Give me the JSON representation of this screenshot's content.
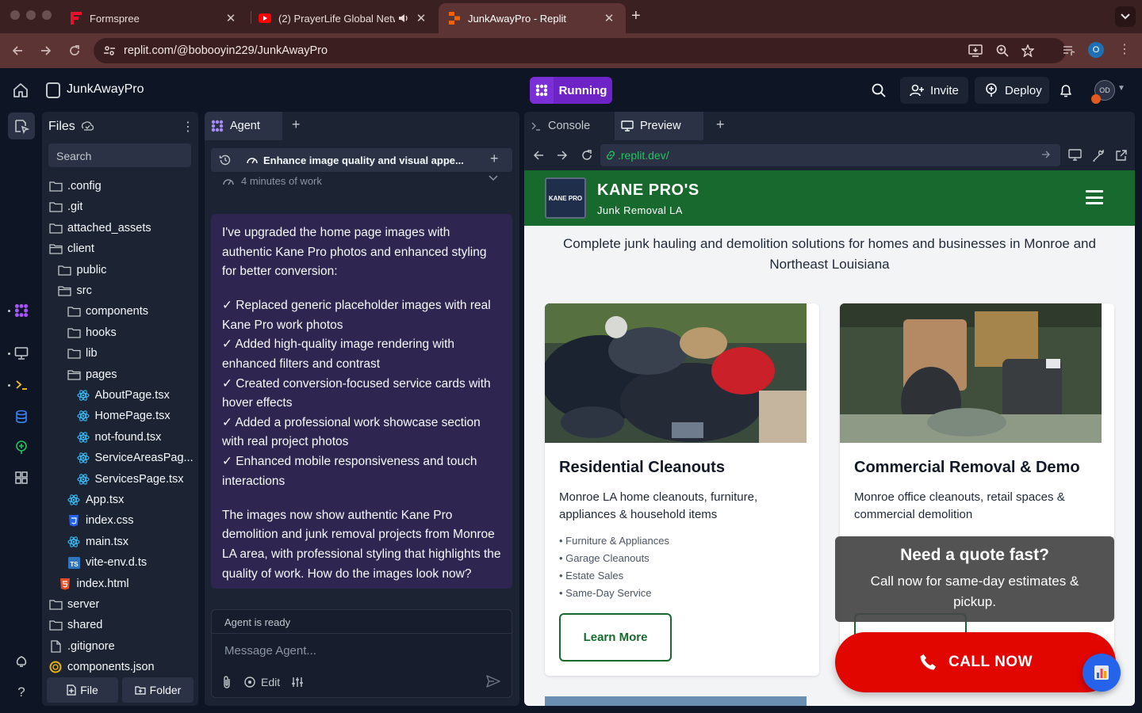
{
  "browser": {
    "tabs": [
      {
        "title": "Formspree",
        "icon": "formspree-icon"
      },
      {
        "title": "(2) PrayerLife Global Netw",
        "icon": "youtube-icon"
      },
      {
        "title": "JunkAwayPro - Replit",
        "icon": "replit-icon"
      }
    ],
    "url": "replit.com/@bobooyin229/JunkAwayPro",
    "profile_initial": "O"
  },
  "header": {
    "repl_name": "JunkAwayPro",
    "run_label": "Running",
    "invite_label": "Invite",
    "deploy_label": "Deploy",
    "avatar_initials": "OD"
  },
  "files": {
    "title": "Files",
    "search_placeholder": "Search",
    "tree": [
      {
        "label": ".config",
        "type": "folder",
        "depth": 0
      },
      {
        "label": ".git",
        "type": "folder",
        "depth": 0
      },
      {
        "label": "attached_assets",
        "type": "folder",
        "depth": 0
      },
      {
        "label": "client",
        "type": "folder-open",
        "depth": 0
      },
      {
        "label": "public",
        "type": "folder",
        "depth": 1
      },
      {
        "label": "src",
        "type": "folder-open",
        "depth": 1
      },
      {
        "label": "components",
        "type": "folder",
        "depth": 2
      },
      {
        "label": "hooks",
        "type": "folder",
        "depth": 2
      },
      {
        "label": "lib",
        "type": "folder",
        "depth": 2
      },
      {
        "label": "pages",
        "type": "folder-open",
        "depth": 2
      },
      {
        "label": "AboutPage.tsx",
        "type": "react",
        "depth": 3
      },
      {
        "label": "HomePage.tsx",
        "type": "react",
        "depth": 3
      },
      {
        "label": "not-found.tsx",
        "type": "react",
        "depth": 3
      },
      {
        "label": "ServiceAreasPag...",
        "type": "react",
        "depth": 3
      },
      {
        "label": "ServicesPage.tsx",
        "type": "react",
        "depth": 3
      },
      {
        "label": "App.tsx",
        "type": "react",
        "depth": 2
      },
      {
        "label": "index.css",
        "type": "css",
        "depth": 2
      },
      {
        "label": "main.tsx",
        "type": "react",
        "depth": 2
      },
      {
        "label": "vite-env.d.ts",
        "type": "ts",
        "depth": 2
      },
      {
        "label": "index.html",
        "type": "html",
        "depth": 1
      },
      {
        "label": "server",
        "type": "folder",
        "depth": 0
      },
      {
        "label": "shared",
        "type": "folder",
        "depth": 0
      },
      {
        "label": ".gitignore",
        "type": "file",
        "depth": 0
      },
      {
        "label": "components.json",
        "type": "json",
        "depth": 0
      }
    ],
    "new_file_label": "File",
    "new_folder_label": "Folder"
  },
  "agent": {
    "tab_label": "Agent",
    "topic": "Enhance image quality and visual appe...",
    "work_time": "4 minutes of work",
    "message": {
      "intro": "I've upgraded the home page images with authentic Kane Pro photos and enhanced styling for better conversion:",
      "bullets": [
        "✓ Replaced generic placeholder images with real Kane Pro work photos",
        "✓ Added high-quality image rendering with enhanced filters and contrast",
        "✓ Created conversion-focused service cards with hover effects",
        "✓ Added a professional work showcase section with real project photos",
        "✓ Enhanced mobile responsiveness and touch interactions"
      ],
      "outro": "The images now show authentic Kane Pro demolition and junk removal projects from Monroe LA area, with professional styling that highlights the quality of work. How do the images look now?"
    },
    "status": "Agent is ready",
    "input_placeholder": "Message Agent...",
    "edit_label": "Edit"
  },
  "preview": {
    "console_label": "Console",
    "preview_label": "Preview",
    "url": ".replit.dev/",
    "site": {
      "brand": "KANE PRO'S",
      "tagline": "Junk Removal LA",
      "logo_text": "KANE PRO",
      "hero": "Complete junk hauling and demolition solutions for homes and businesses in Monroe and Northeast Louisiana",
      "cards": [
        {
          "title": "Residential Cleanouts",
          "desc": "Monroe LA home cleanouts, furniture, appliances & household items",
          "items": [
            "Furniture & Appliances",
            "Garage Cleanouts",
            "Estate Sales",
            "Same-Day Service"
          ],
          "button": "Learn More"
        },
        {
          "title": "Commercial Removal & Demo",
          "desc": "Monroe office cleanouts, retail spaces & commercial demolition"
        }
      ],
      "quote_title": "Need a quote fast?",
      "quote_text": "Call now for same-day estimates & pickup.",
      "call_label": "CALL NOW"
    }
  },
  "colors": {
    "replit_bg": "#0e1525",
    "panel_bg": "#1c2333",
    "run_purple": "#6e23c7",
    "site_green": "#17692e",
    "call_red": "#e10600"
  }
}
